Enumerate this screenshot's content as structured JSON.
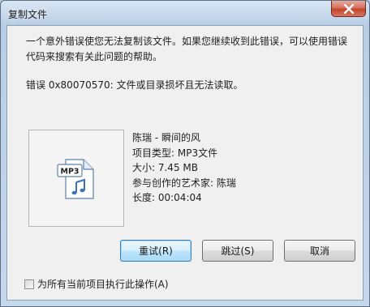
{
  "window": {
    "title": "复制文件"
  },
  "message": {
    "line1": "一个意外错误使您无法复制该文件。如果您继续收到此错误，可以使用错误代码来搜索有关此问题的帮助。",
    "error": "错误 0x80070570: 文件或目录损坏且无法读取。"
  },
  "file": {
    "icon_label": "MP3",
    "name": "陈瑞 - 瞬间的风",
    "type": "项目类型: MP3文件",
    "size": "大小: 7.45 MB",
    "artist": "参与创作的艺术家: 陈瑞",
    "duration": "长度: 00:04:04"
  },
  "buttons": {
    "retry": "重试(R)",
    "skip": "跳过(S)",
    "cancel": "取消"
  },
  "checkbox": {
    "label": "为所有当前项目执行此操作(A)",
    "checked": false
  },
  "colors": {
    "accent_border": "#3c7fb1",
    "close_red": "#c2432b",
    "icon_blue": "#3a73b8"
  }
}
